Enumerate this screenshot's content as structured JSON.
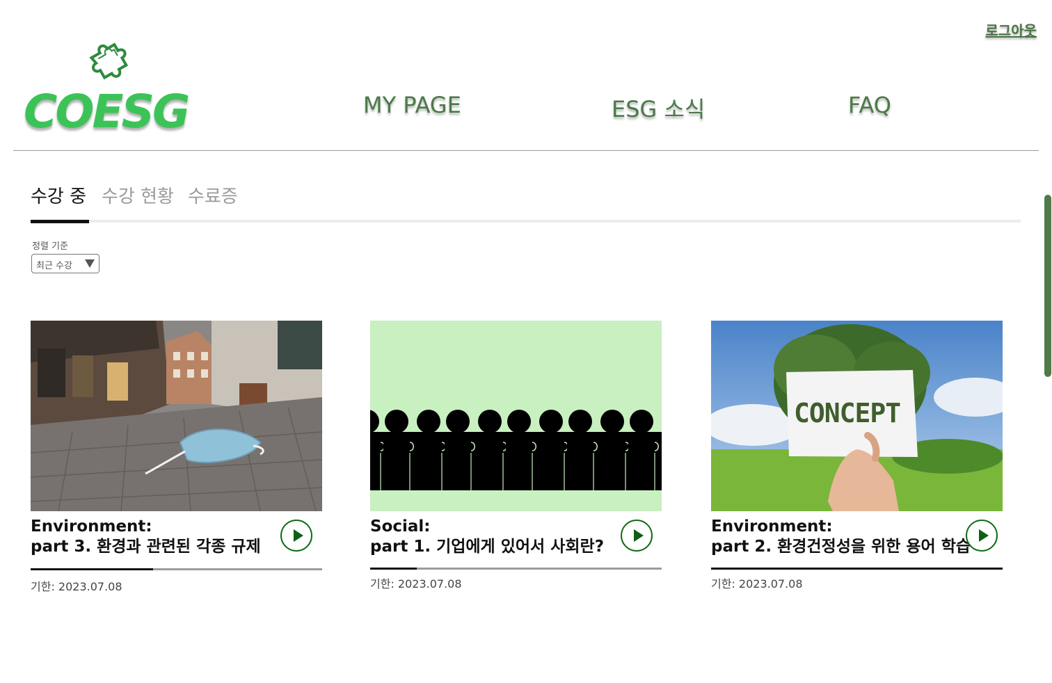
{
  "header": {
    "logout": "로그아웃",
    "logo_text": "COESG",
    "nav": [
      "MY PAGE",
      "ESG 소식",
      "FAQ"
    ]
  },
  "tabs": [
    {
      "label": "수강 중",
      "active": true
    },
    {
      "label": "수강 현황",
      "active": false
    },
    {
      "label": "수료증",
      "active": false
    }
  ],
  "sort": {
    "label": "정렬 기준",
    "selected": "최근 수강"
  },
  "courses": [
    {
      "category": "Environment:",
      "title": "part 3. 환경과 관련된 각종 규제",
      "deadline": "기한: 2023.07.08",
      "progress": 0.42,
      "thumbnail": "face-mask-on-cobblestone-street"
    },
    {
      "category": "Social:",
      "title": "part 1. 기업에게 있어서 사회란?",
      "deadline": "기한: 2023.07.08",
      "progress": 0.16,
      "thumbnail": "puzzle-people-silhouettes"
    },
    {
      "category": "Environment:",
      "title": "part 2. 환경건정성을 위한 용어 학습",
      "deadline": "기한: 2023.07.08",
      "progress": 1.0,
      "thumbnail": "concept-card-with-tree"
    }
  ],
  "colors": {
    "brand_green": "#3cc358",
    "nav_green": "#4a7a48",
    "play_green": "#116b17",
    "social_bg": "#c9f0c0"
  }
}
